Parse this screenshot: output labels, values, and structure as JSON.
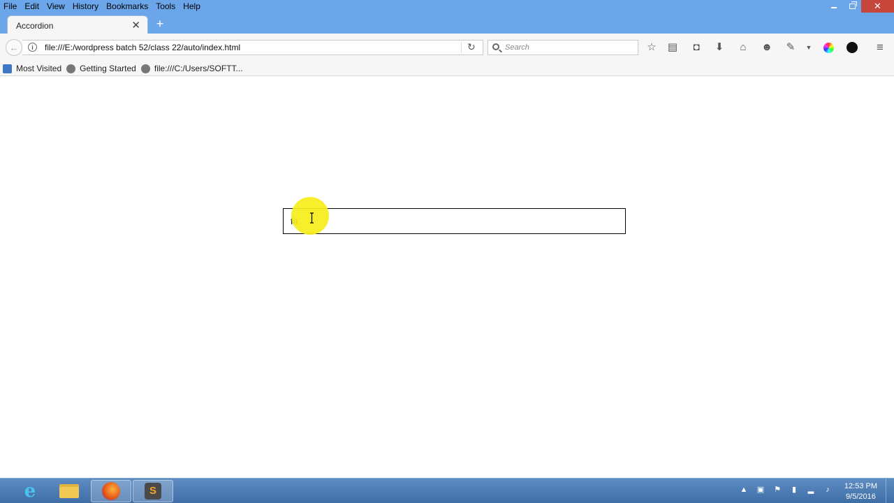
{
  "menu": {
    "items": [
      {
        "label": "File"
      },
      {
        "label": "Edit"
      },
      {
        "label": "View"
      },
      {
        "label": "History"
      },
      {
        "label": "Bookmarks"
      },
      {
        "label": "Tools"
      },
      {
        "label": "Help"
      }
    ]
  },
  "tab": {
    "title": "Accordion",
    "close_glyph": "✕",
    "new_tab_glyph": "+"
  },
  "navbar": {
    "url": "file:///E:/wordpress batch 52/class 22/auto/index.html",
    "search_placeholder": "Search"
  },
  "bookmarks": {
    "items": [
      {
        "label": "Most Visited"
      },
      {
        "label": "Getting Started"
      },
      {
        "label": "file:///C:/Users/SOFTT..."
      }
    ]
  },
  "content": {
    "input_value": "fa"
  },
  "taskbar": {
    "sublime_glyph": "S",
    "clock": {
      "time": "12:53 PM",
      "date": "9/5/2016"
    }
  },
  "colors": {
    "titlebar": "#6ca6ea",
    "close_button": "#c7463c",
    "cursor_highlight": "#f6ee1a",
    "taskbar": "#4a7ab4"
  },
  "icons": {
    "toolbar": [
      "star-icon",
      "reading-list-icon",
      "pocket-icon",
      "download-icon",
      "home-icon",
      "hello-icon",
      "tools-icon",
      "color-icon",
      "dark-circle-icon",
      "hamburger-menu-icon"
    ]
  }
}
